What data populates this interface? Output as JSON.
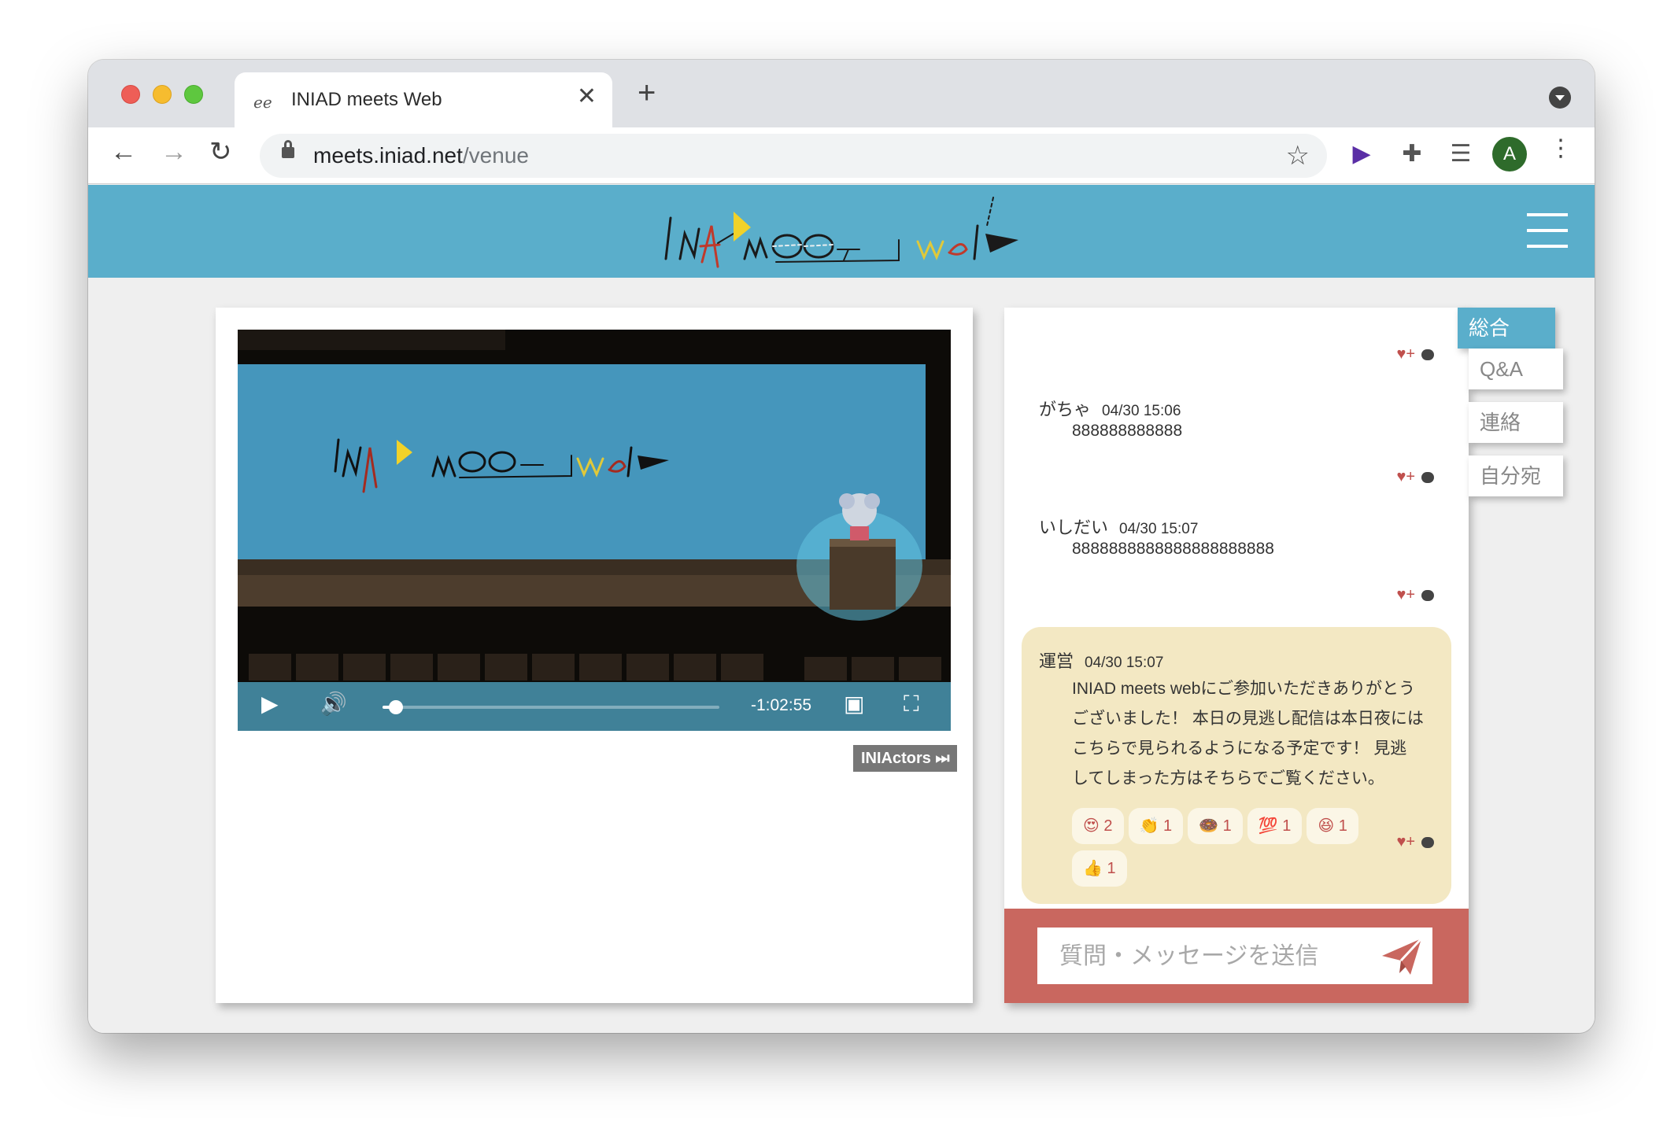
{
  "browser": {
    "tab_title": "INIAD meets Web",
    "tab_favicon": "ee",
    "url_host": "meets.iniad.net",
    "url_path": "/venue",
    "avatar_letter": "A"
  },
  "icons": {
    "back": "back-arrow-icon",
    "forward": "forward-arrow-icon",
    "reload": "reload-icon",
    "lock": "lock-icon",
    "bookmark": "star-icon",
    "extensions": "puzzle-icon",
    "media": "media-queue-icon",
    "menu": "kebab-menu-icon",
    "send": "paper-plane-icon",
    "heart": "heart-plus-icon",
    "reply": "speech-bubble-icon"
  },
  "colors": {
    "header": "#5aaecb",
    "composer": "#c9675f",
    "staff_message": "#f3e8c3",
    "reaction_text": "#c0504d"
  },
  "player": {
    "time_remaining": "-1:02:55",
    "progress_fraction": 0.04,
    "actors_button": "INIActors"
  },
  "chat": {
    "messages": [
      {
        "author": "がちゃ",
        "time": "04/30 15:06",
        "text": "888888888888"
      },
      {
        "author": "いしだい",
        "time": "04/30 15:07",
        "text": "8888888888888888888888"
      }
    ],
    "staff_message": {
      "author": "運営",
      "time": "04/30 15:07",
      "lines": [
        "INIAD meets webにご参加いただきありがとう",
        "ございました！ 本日の見逃し配信は本日夜には",
        "こちらで見られるようになる予定です！ 見逃",
        "してしまった方はそちらでご覧ください。"
      ],
      "reactions": [
        {
          "emoji": "😍",
          "count": "2"
        },
        {
          "emoji": "👏",
          "count": "1"
        },
        {
          "emoji": "🍩",
          "count": "1"
        },
        {
          "emoji": "💯",
          "count": "1"
        },
        {
          "emoji": "😆",
          "count": "1"
        },
        {
          "emoji": "👍",
          "count": "1"
        }
      ]
    },
    "composer_placeholder": "質問・メッセージを送信"
  },
  "side_tabs": [
    "総合",
    "Q&A",
    "連絡",
    "自分宛"
  ]
}
